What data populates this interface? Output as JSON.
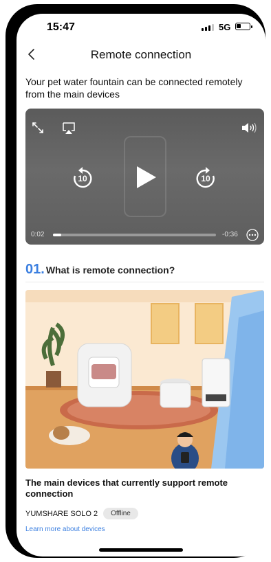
{
  "status_bar": {
    "time": "15:47",
    "network": "5G"
  },
  "nav": {
    "title": "Remote connection"
  },
  "intro_text": "Your pet water fountain can be connected remotely from the main devices",
  "video": {
    "current_time": "0:02",
    "remaining_time": "-0:36",
    "progress": 0.05,
    "skip_back_seconds": "10",
    "skip_forward_seconds": "10"
  },
  "section": {
    "number": "01.",
    "title": "What is remote connection?"
  },
  "caption": "The main devices that currently support remote connection",
  "device": {
    "name": "YUMSHARE SOLO 2",
    "status": "Offline"
  },
  "learn_more": "Learn more about devices",
  "colors": {
    "accent": "#3b7fe0",
    "badge_bg": "#e8e8e8"
  },
  "icons": [
    "back-chevron-icon",
    "fullscreen-icon",
    "airplay-icon",
    "volume-icon",
    "skip-back-10-icon",
    "play-icon",
    "skip-forward-10-icon",
    "more-icon"
  ]
}
